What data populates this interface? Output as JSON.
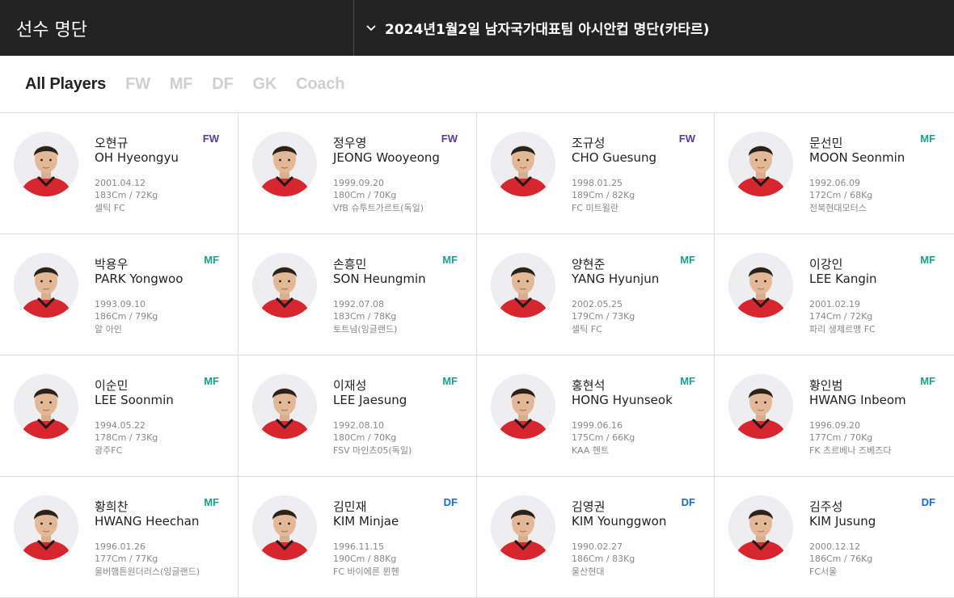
{
  "header": {
    "section_title": "선수 명단",
    "roster_title": "2024년1월2일 남자국가대표팀 아시안컵 명단(카타르)",
    "roster_icon": "chevron-down-icon"
  },
  "filters": [
    {
      "label": "All Players",
      "active": true
    },
    {
      "label": "FW",
      "active": false
    },
    {
      "label": "MF",
      "active": false
    },
    {
      "label": "DF",
      "active": false
    },
    {
      "label": "GK",
      "active": false
    },
    {
      "label": "Coach",
      "active": false
    }
  ],
  "colors": {
    "fw": "#5a3a9a",
    "mf": "#19a08d",
    "df": "#1f6bc2",
    "jersey": "#d8262e",
    "header_bg": "#232323"
  },
  "players": [
    {
      "name_ko": "오현규",
      "name_en": "OH Hyeongyu",
      "position": "FW",
      "birth": "2001.04.12",
      "body": "183Cm / 72Kg",
      "club": "셀틱 FC"
    },
    {
      "name_ko": "정우영",
      "name_en": "JEONG Wooyeong",
      "position": "FW",
      "birth": "1999.09.20",
      "body": "180Cm / 70Kg",
      "club": "VfB 슈투트가르트(독일)"
    },
    {
      "name_ko": "조규성",
      "name_en": "CHO Guesung",
      "position": "FW",
      "birth": "1998.01.25",
      "body": "189Cm / 82Kg",
      "club": "FC 미트윌란"
    },
    {
      "name_ko": "문선민",
      "name_en": "MOON Seonmin",
      "position": "MF",
      "birth": "1992.06.09",
      "body": "172Cm / 68Kg",
      "club": "전북현대모터스"
    },
    {
      "name_ko": "박용우",
      "name_en": "PARK Yongwoo",
      "position": "MF",
      "birth": "1993.09.10",
      "body": "186Cm / 79Kg",
      "club": "알 아인"
    },
    {
      "name_ko": "손흥민",
      "name_en": "SON Heungmin",
      "position": "MF",
      "birth": "1992.07.08",
      "body": "183Cm / 78Kg",
      "club": "토트넘(잉글랜드)"
    },
    {
      "name_ko": "양현준",
      "name_en": "YANG Hyunjun",
      "position": "MF",
      "birth": "2002.05.25",
      "body": "179Cm / 73Kg",
      "club": "셀틱 FC"
    },
    {
      "name_ko": "이강인",
      "name_en": "LEE Kangin",
      "position": "MF",
      "birth": "2001.02.19",
      "body": "174Cm / 72Kg",
      "club": "파리 생제르맹 FC"
    },
    {
      "name_ko": "이순민",
      "name_en": "LEE Soonmin",
      "position": "MF",
      "birth": "1994.05.22",
      "body": "178Cm / 73Kg",
      "club": "광주FC"
    },
    {
      "name_ko": "이재성",
      "name_en": "LEE Jaesung",
      "position": "MF",
      "birth": "1992.08.10",
      "body": "180Cm / 70Kg",
      "club": "FSV 마인츠05(독일)"
    },
    {
      "name_ko": "홍현석",
      "name_en": "HONG Hyunseok",
      "position": "MF",
      "birth": "1999.06.16",
      "body": "175Cm / 66Kg",
      "club": "KAA 헨트"
    },
    {
      "name_ko": "황인범",
      "name_en": "HWANG Inbeom",
      "position": "MF",
      "birth": "1996.09.20",
      "body": "177Cm / 70Kg",
      "club": "FK 츠르베나 즈베즈다"
    },
    {
      "name_ko": "황희찬",
      "name_en": "HWANG Heechan",
      "position": "MF",
      "birth": "1996.01.26",
      "body": "177Cm / 77Kg",
      "club": "울버햄튼원더러스(잉글랜드)"
    },
    {
      "name_ko": "김민재",
      "name_en": "KIM Minjae",
      "position": "DF",
      "birth": "1996.11.15",
      "body": "190Cm / 88Kg",
      "club": "FC 바이에른 뮌헨"
    },
    {
      "name_ko": "김영권",
      "name_en": "KIM Younggwon",
      "position": "DF",
      "birth": "1990.02.27",
      "body": "186Cm / 83Kg",
      "club": "울산현대"
    },
    {
      "name_ko": "김주성",
      "name_en": "KIM Jusung",
      "position": "DF",
      "birth": "2000.12.12",
      "body": "186Cm / 76Kg",
      "club": "FC서울"
    }
  ]
}
